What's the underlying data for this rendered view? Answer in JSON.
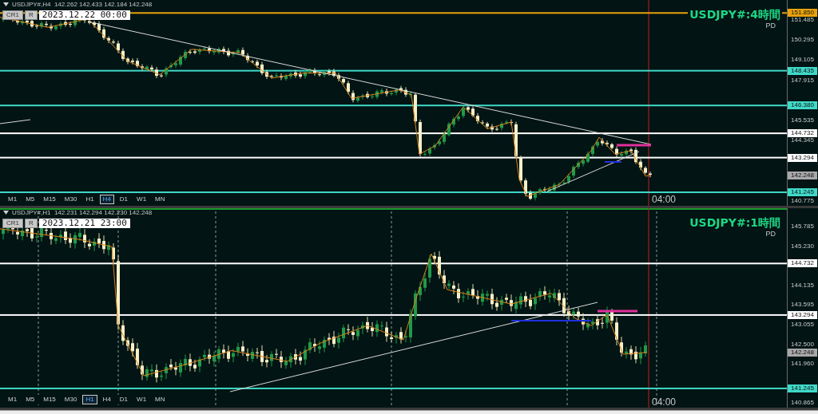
{
  "panels": [
    {
      "header": "USDJPY#,H4  142.262 142.433 142.184 142.248",
      "buttons": [
        "CR1",
        "R"
      ],
      "date": "2023.12.22 00:00",
      "title": "USDJPY#:4時間",
      "subtitle": "PD",
      "axis_labels": [
        "151.485",
        "150.295",
        "149.105",
        "147.915",
        "145.535",
        "144.345",
        "140.775"
      ],
      "levels": [
        {
          "price": "151.850",
          "color": "#e8a20c",
          "kind": "line"
        },
        {
          "price": "148.435",
          "color": "#40d9c8",
          "kind": "line"
        },
        {
          "price": "146.380",
          "color": "#40d9c8",
          "kind": "line"
        },
        {
          "price": "144.732",
          "color": "#ffffff",
          "kind": "line"
        },
        {
          "price": "143.294",
          "color": "#ffffff",
          "kind": "line"
        },
        {
          "price": "142.248",
          "color": "#a8a8a8",
          "kind": "bid"
        },
        {
          "price": "141.245",
          "color": "#40d9c8",
          "kind": "line"
        }
      ],
      "timeframes": [
        {
          "label": "M1",
          "selected": false
        },
        {
          "label": "M5",
          "selected": false
        },
        {
          "label": "M15",
          "selected": false
        },
        {
          "label": "M30",
          "selected": false
        },
        {
          "label": "H1",
          "selected": false
        },
        {
          "label": "H4",
          "selected": true
        },
        {
          "label": "D1",
          "selected": false
        },
        {
          "label": "W1",
          "selected": false
        },
        {
          "label": "MN",
          "selected": false
        }
      ],
      "time_label": "04:00"
    },
    {
      "header": "USDJPY#,H1  142.231 142.294 142.230 142.248",
      "buttons": [
        "CR1",
        "R"
      ],
      "date": "2023.12.21 23:00",
      "title": "USDJPY#:1時間",
      "subtitle": "PD",
      "axis_labels": [
        "145.785",
        "145.230",
        "144.135",
        "143.595",
        "143.055",
        "142.500",
        "141.960",
        "140.865"
      ],
      "levels": [
        {
          "price": "144.732",
          "color": "#ffffff",
          "kind": "line"
        },
        {
          "price": "143.294",
          "color": "#ffffff",
          "kind": "line"
        },
        {
          "price": "142.248",
          "color": "#a8a8a8",
          "kind": "bid"
        },
        {
          "price": "141.245",
          "color": "#40d9c8",
          "kind": "line"
        }
      ],
      "timeframes": [
        {
          "label": "M1",
          "selected": false
        },
        {
          "label": "M5",
          "selected": false
        },
        {
          "label": "M15",
          "selected": false
        },
        {
          "label": "M30",
          "selected": false
        },
        {
          "label": "H1",
          "selected": true
        },
        {
          "label": "H4",
          "selected": false
        },
        {
          "label": "D1",
          "selected": false
        },
        {
          "label": "W1",
          "selected": false
        },
        {
          "label": "MN",
          "selected": false
        }
      ],
      "time_label": "04:00"
    }
  ]
}
